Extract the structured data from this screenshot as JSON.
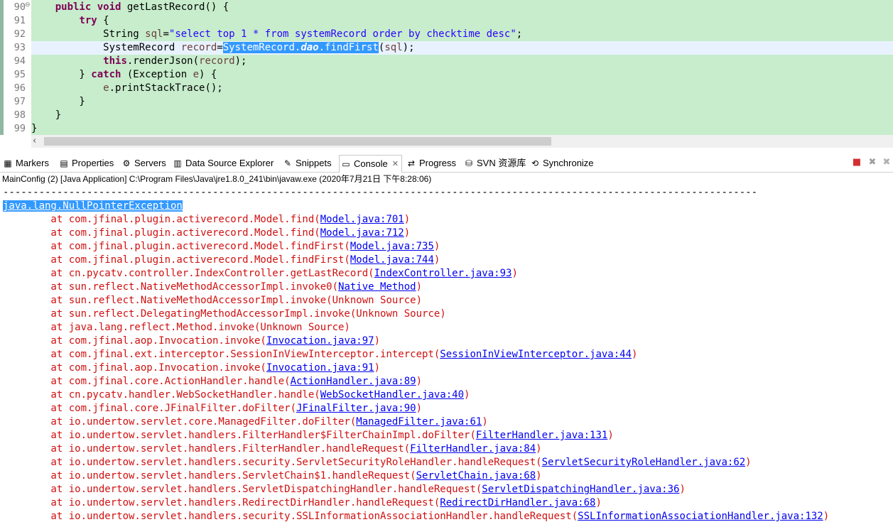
{
  "editor": {
    "line_numbers": [
      "90",
      "91",
      "92",
      "93",
      "94",
      "95",
      "96",
      "97",
      "98",
      "99"
    ],
    "lines": [
      [
        {
          "t": "    "
        },
        {
          "t": "public",
          "c": "kw"
        },
        {
          "t": " "
        },
        {
          "t": "void",
          "c": "kw"
        },
        {
          "t": " getLastRecord() {"
        }
      ],
      [
        {
          "t": "        "
        },
        {
          "t": "try",
          "c": "kw"
        },
        {
          "t": " {"
        }
      ],
      [
        {
          "t": "            String "
        },
        {
          "t": "sql",
          "c": "var"
        },
        {
          "t": "="
        },
        {
          "t": "\"select top 1 * from systemRecord order by checktime desc\"",
          "c": "str"
        },
        {
          "t": ";"
        }
      ],
      [
        {
          "t": "            SystemRecord "
        },
        {
          "t": "record",
          "c": "var"
        },
        {
          "t": "="
        },
        {
          "t": "SystemRecord.",
          "c": "sel"
        },
        {
          "t": "dao",
          "c": "sel",
          "i": true
        },
        {
          "t": ".findFirst",
          "c": "sel"
        },
        {
          "t": "("
        },
        {
          "t": "sql",
          "c": "var"
        },
        {
          "t": ");"
        }
      ],
      [
        {
          "t": "            "
        },
        {
          "t": "this",
          "c": "kw"
        },
        {
          "t": ".renderJson("
        },
        {
          "t": "record",
          "c": "var"
        },
        {
          "t": ");"
        }
      ],
      [
        {
          "t": "        } "
        },
        {
          "t": "catch",
          "c": "kw"
        },
        {
          "t": " (Exception "
        },
        {
          "t": "e",
          "c": "var"
        },
        {
          "t": ") {"
        }
      ],
      [
        {
          "t": "            "
        },
        {
          "t": "e",
          "c": "var"
        },
        {
          "t": ".printStackTrace();"
        }
      ],
      [
        {
          "t": "        }"
        }
      ],
      [
        {
          "t": "    }"
        }
      ],
      [
        {
          "t": "}"
        }
      ]
    ],
    "current_line_index": 3,
    "fold_marker": "⊖"
  },
  "tabs": [
    {
      "label": "Markers",
      "icon": "markers-icon",
      "glyph": "▦"
    },
    {
      "label": "Properties",
      "icon": "properties-icon",
      "glyph": "▤"
    },
    {
      "label": "Servers",
      "icon": "servers-icon",
      "glyph": "⚙"
    },
    {
      "label": "Data Source Explorer",
      "icon": "data-source-icon",
      "glyph": "▥"
    },
    {
      "label": "Snippets",
      "icon": "snippets-icon",
      "glyph": "✎"
    },
    {
      "label": "Console",
      "icon": "console-icon",
      "glyph": "▭",
      "active": true,
      "close": "✕"
    },
    {
      "label": "Progress",
      "icon": "progress-icon",
      "glyph": "⇄"
    },
    {
      "label": "SVN 资源库",
      "icon": "svn-icon",
      "glyph": "⛁"
    },
    {
      "label": "Synchronize",
      "icon": "synchronize-icon",
      "glyph": "⟲"
    }
  ],
  "toolbar": [
    {
      "name": "terminate-icon",
      "glyph": "■",
      "color": "#d32f2f"
    },
    {
      "name": "remove-launch-icon",
      "glyph": "✖",
      "color": "#9e9e9e"
    },
    {
      "name": "remove-all-icon",
      "glyph": "✖",
      "color": "#b0b0b0"
    }
  ],
  "console": {
    "description": "MainConfig (2) [Java Application] C:\\Program Files\\Java\\jre1.8.0_241\\bin\\javaw.exe (2020年7月21日 下午8:28:06)",
    "separator": "------------------------------------------------------------------------------------------------------------------------------",
    "exception": "java.lang.NullPointerException",
    "stack": [
      {
        "pre": "\tat com.jfinal.plugin.activerecord.Model.find(",
        "link": "Model.java:701",
        "post": ")"
      },
      {
        "pre": "\tat com.jfinal.plugin.activerecord.Model.find(",
        "link": "Model.java:712",
        "post": ")"
      },
      {
        "pre": "\tat com.jfinal.plugin.activerecord.Model.findFirst(",
        "link": "Model.java:735",
        "post": ")"
      },
      {
        "pre": "\tat com.jfinal.plugin.activerecord.Model.findFirst(",
        "link": "Model.java:744",
        "post": ")"
      },
      {
        "pre": "\tat cn.pycatv.controller.IndexController.getLastRecord(",
        "link": "IndexController.java:93",
        "post": ")"
      },
      {
        "pre": "\tat sun.reflect.NativeMethodAccessorImpl.invoke0(",
        "link": "Native Method",
        "post": ")"
      },
      {
        "pre": "\tat sun.reflect.NativeMethodAccessorImpl.invoke(Unknown Source)",
        "link": "",
        "post": ""
      },
      {
        "pre": "\tat sun.reflect.DelegatingMethodAccessorImpl.invoke(Unknown Source)",
        "link": "",
        "post": ""
      },
      {
        "pre": "\tat java.lang.reflect.Method.invoke(Unknown Source)",
        "link": "",
        "post": ""
      },
      {
        "pre": "\tat com.jfinal.aop.Invocation.invoke(",
        "link": "Invocation.java:97",
        "post": ")"
      },
      {
        "pre": "\tat com.jfinal.ext.interceptor.SessionInViewInterceptor.intercept(",
        "link": "SessionInViewInterceptor.java:44",
        "post": ")"
      },
      {
        "pre": "\tat com.jfinal.aop.Invocation.invoke(",
        "link": "Invocation.java:91",
        "post": ")"
      },
      {
        "pre": "\tat com.jfinal.core.ActionHandler.handle(",
        "link": "ActionHandler.java:89",
        "post": ")"
      },
      {
        "pre": "\tat cn.pycatv.handler.WebSocketHandler.handle(",
        "link": "WebSocketHandler.java:40",
        "post": ")"
      },
      {
        "pre": "\tat com.jfinal.core.JFinalFilter.doFilter(",
        "link": "JFinalFilter.java:90",
        "post": ")"
      },
      {
        "pre": "\tat io.undertow.servlet.core.ManagedFilter.doFilter(",
        "link": "ManagedFilter.java:61",
        "post": ")"
      },
      {
        "pre": "\tat io.undertow.servlet.handlers.FilterHandler$FilterChainImpl.doFilter(",
        "link": "FilterHandler.java:131",
        "post": ")"
      },
      {
        "pre": "\tat io.undertow.servlet.handlers.FilterHandler.handleRequest(",
        "link": "FilterHandler.java:84",
        "post": ")"
      },
      {
        "pre": "\tat io.undertow.servlet.handlers.security.ServletSecurityRoleHandler.handleRequest(",
        "link": "ServletSecurityRoleHandler.java:62",
        "post": ")"
      },
      {
        "pre": "\tat io.undertow.servlet.handlers.ServletChain$1.handleRequest(",
        "link": "ServletChain.java:68",
        "post": ")"
      },
      {
        "pre": "\tat io.undertow.servlet.handlers.ServletDispatchingHandler.handleRequest(",
        "link": "ServletDispatchingHandler.java:36",
        "post": ")"
      },
      {
        "pre": "\tat io.undertow.servlet.handlers.RedirectDirHandler.handleRequest(",
        "link": "RedirectDirHandler.java:68",
        "post": ")"
      },
      {
        "pre": "\tat io.undertow.servlet.handlers.security.SSLInformationAssociationHandler.handleRequest(",
        "link": "SSLInformationAssociationHandler.java:132",
        "post": ")"
      }
    ]
  }
}
